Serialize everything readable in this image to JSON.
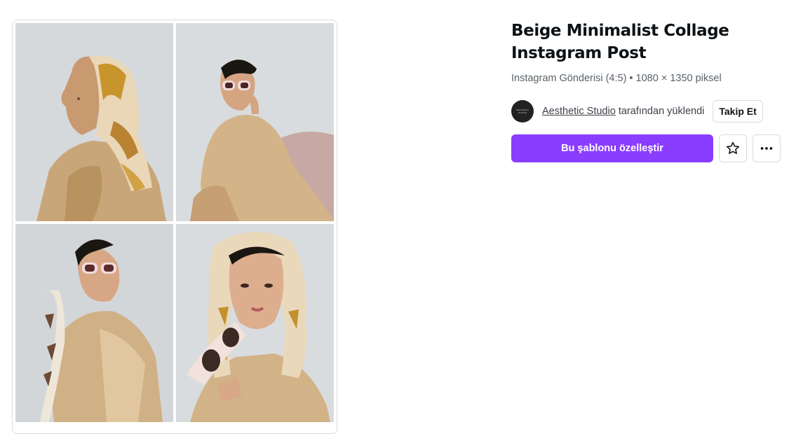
{
  "template": {
    "title": "Beige Minimalist Collage Instagram Post",
    "meta": "Instagram Gönderisi (4:5) • 1080 × 1350 piksel",
    "author": {
      "avatar_text": "AESTHETIC STUDIO",
      "name": "Aesthetic Studio",
      "uploaded_suffix": "tarafından yüklendi",
      "follow_label": "Takip Et"
    },
    "actions": {
      "customize_label": "Bu şablonu özelleştir",
      "favorite_icon": "star-icon",
      "more_icon": "more-horizontal-icon"
    },
    "preview": {
      "photos": [
        "photo-scarf-profile",
        "photo-sunglasses-seated",
        "photo-sunglasses-over-shoulder",
        "photo-holding-sunglasses"
      ]
    }
  },
  "colors": {
    "accent": "#8b3dff",
    "background": "#ffffff",
    "border": "#d9dbe0",
    "text": "#0d1216",
    "muted": "#5b6268"
  }
}
